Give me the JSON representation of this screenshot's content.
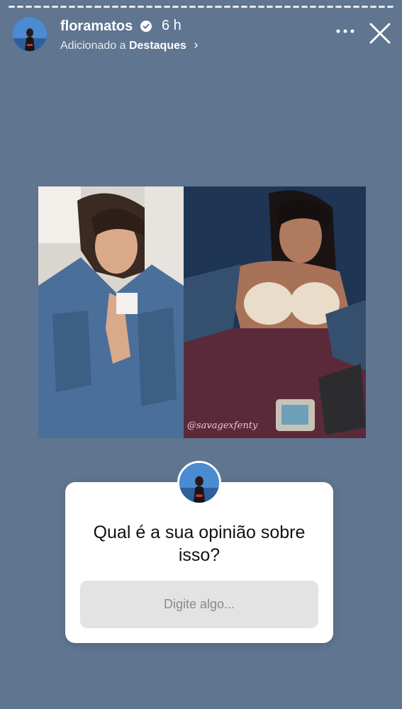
{
  "story": {
    "username": "floramatos",
    "time": "6 h",
    "subtitle_prefix": "Adicionado a",
    "subtitle_highlight": "Destaques",
    "segments": 45
  },
  "photo": {
    "watermark": "@savagexfenty"
  },
  "question": {
    "text": "Qual é a sua opinião sobre isso?",
    "placeholder": "Digite algo..."
  },
  "icons": [
    "verified-icon",
    "more-icon",
    "close-icon",
    "chevron-right-icon"
  ]
}
